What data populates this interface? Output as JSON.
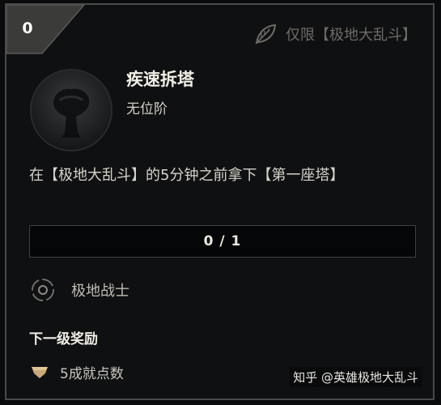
{
  "badge": {
    "count": "0"
  },
  "mode": {
    "label": "仅限【极地大乱斗】",
    "icon": "leaf-icon"
  },
  "achievement": {
    "emblem_icon": "tower-emblem-icon",
    "title": "疾速拆塔",
    "tier": "无位阶",
    "description": "在【极地大乱斗】的5分钟之前拿下【第一座塔】",
    "progress": "0 / 1"
  },
  "category": {
    "icon": "target-icon",
    "label": "极地战士"
  },
  "next_reward": {
    "heading": "下一级奖励",
    "icon": "gem-icon",
    "label": "5成就点数"
  },
  "watermark": "知乎 @英雄极地大乱斗",
  "colors": {
    "background": "#0f1012",
    "border": "#4a4a49",
    "title": "#f2efe6",
    "muted": "#6d6b66",
    "reward_gem": "#c9a97a"
  }
}
